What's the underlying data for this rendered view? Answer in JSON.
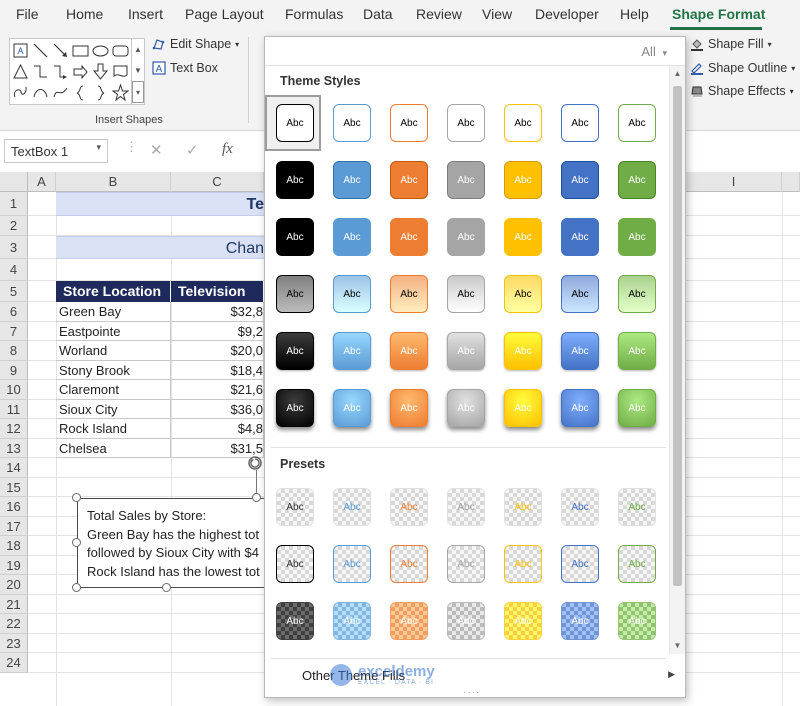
{
  "ribbon_tabs": [
    "File",
    "Home",
    "Insert",
    "Page Layout",
    "Formulas",
    "Data",
    "Review",
    "View",
    "Developer",
    "Help",
    "Shape Format"
  ],
  "active_tab": "Shape Format",
  "ribbon": {
    "edit_shape": "Edit Shape",
    "text_box": "Text Box",
    "insert_shapes_label": "Insert Shapes",
    "shape_fill": "Shape Fill",
    "shape_outline": "Shape Outline",
    "shape_effects": "Shape Effects"
  },
  "formula_bar": {
    "name_box": "TextBox 1",
    "fx": "fx"
  },
  "columns": [
    "A",
    "B",
    "C",
    "I"
  ],
  "rows": [
    "1",
    "2",
    "3",
    "4",
    "5",
    "6",
    "7",
    "8",
    "9",
    "10",
    "11",
    "12",
    "13",
    "14",
    "15",
    "16",
    "17",
    "18",
    "19",
    "20",
    "21",
    "22",
    "23",
    "24"
  ],
  "sheet": {
    "title_fragment": "Te",
    "subtitle_fragment": "Chan",
    "headers": [
      "Store Location",
      "Television"
    ],
    "data": [
      {
        "store": "Green Bay",
        "value": "$32,8"
      },
      {
        "store": "Eastpointe",
        "value": "$9,2"
      },
      {
        "store": "Worland",
        "value": "$20,0"
      },
      {
        "store": "Stony Brook",
        "value": "$18,4"
      },
      {
        "store": "Claremont",
        "value": "$21,6"
      },
      {
        "store": "Sioux City",
        "value": "$36,0"
      },
      {
        "store": "Rock Island",
        "value": "$4,8"
      },
      {
        "store": "Chelsea",
        "value": "$31,5"
      }
    ]
  },
  "textbox": {
    "lines": [
      "Total Sales by Store:",
      "Green Bay has the highest tot",
      "followed by Sioux City with $4",
      "Rock Island has the lowest tot"
    ]
  },
  "panel": {
    "filter": "All",
    "theme_styles_title": "Theme Styles",
    "presets_title": "Presets",
    "tile_label": "Abc",
    "other_fills": "Other Theme Fills"
  },
  "palette": {
    "colors": [
      "#000000",
      "#5b9bd5",
      "#ed7d31",
      "#a5a5a5",
      "#ffc000",
      "#4472c4",
      "#70ad47"
    ],
    "light": [
      "#808080",
      "#9dc3e6",
      "#f4b183",
      "#c9c9c9",
      "#ffd966",
      "#8faadc",
      "#a9d18e"
    ]
  },
  "watermark": {
    "name": "exceldemy",
    "tagline": "EXCEL · DATA · BI"
  }
}
